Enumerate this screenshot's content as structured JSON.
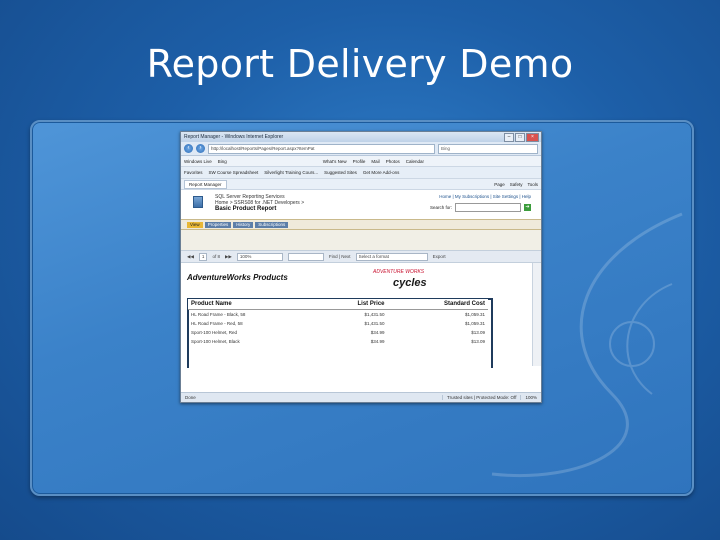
{
  "slide": {
    "title": "Report Delivery Demo"
  },
  "browser": {
    "window_title": "Report Manager - Windows Internet Explorer",
    "url": "http://localhost/Reports/Pages/Report.aspx?ItemPat",
    "search_placeholder": "Bing",
    "links_bar": [
      "Windows Live",
      "Bing",
      "What's New",
      "Profile",
      "Mail",
      "Photos",
      "Calendar"
    ],
    "favorites_bar": [
      "Favorites",
      "SW Course Spreadsheet",
      "Silverlight Training Cours...",
      "Suggested Sites",
      "Get More Add-ons"
    ],
    "tab_label": "Report Manager",
    "command_bar": [
      "Page",
      "Safety",
      "Tools"
    ],
    "status": {
      "left": "Done",
      "zone": "Trusted sites | Protected Mode: Off",
      "zoom": "100%"
    }
  },
  "ssrs": {
    "product": "SQL Server Reporting Services",
    "breadcrumb": "Home > SSRS08 for .NET Developers >",
    "report_name": "Basic Product Report",
    "top_links": "Home | My Subscriptions | Site Settings | Help",
    "search_label": "Search for:",
    "tabs": [
      "View",
      "Properties",
      "History",
      "Subscriptions"
    ],
    "toolbar": {
      "page": "1",
      "of": "of 8",
      "zoom": "100%",
      "find": "Find | Next",
      "format": "Select a format",
      "export": "Export"
    }
  },
  "report": {
    "title": "AdventureWorks Products",
    "logo_top": "ADVENTURE WORKS",
    "logo_main": "cycles",
    "columns": [
      "Product Name",
      "List Price",
      "Standard Cost"
    ],
    "rows": [
      [
        "HL Road Frame - Black, 58",
        "$1,431.50",
        "$1,059.31"
      ],
      [
        "HL Road Frame - Red, 58",
        "$1,431.50",
        "$1,059.31"
      ],
      [
        "Sport-100 Helmet, Red",
        "$34.99",
        "$13.09"
      ],
      [
        "Sport-100 Helmet, Black",
        "$34.99",
        "$13.09"
      ]
    ]
  },
  "colors": {
    "slide_bg": "#1d5fa8",
    "panel": "#3b82c9",
    "ssrs_tab_active": "#e8b735"
  }
}
